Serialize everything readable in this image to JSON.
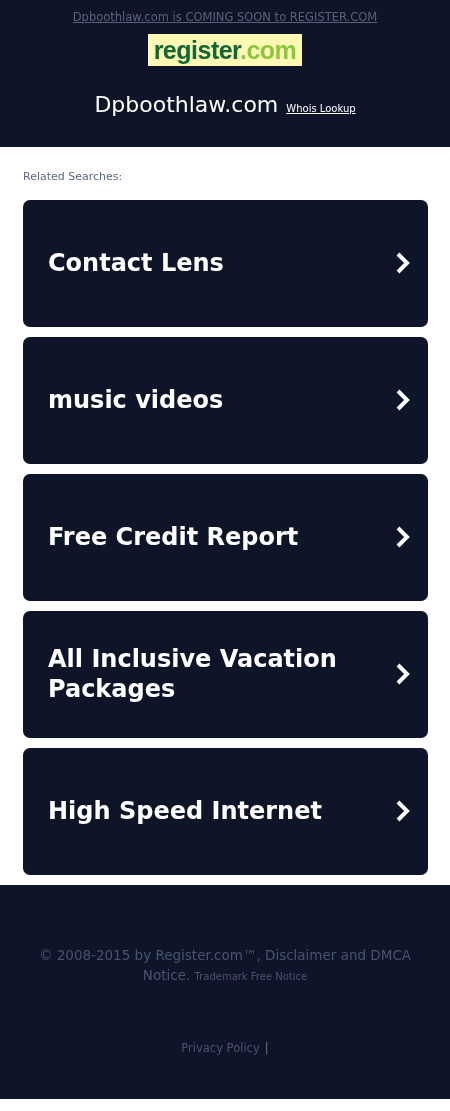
{
  "banner": {
    "text": "Dpboothlaw.com is COMING SOON to REGISTER.COM"
  },
  "logo": {
    "main": "register",
    "suffix": ".com"
  },
  "domain": {
    "name": "Dpboothlaw.com",
    "whois_link": "Whois Lookup"
  },
  "related_searches": {
    "heading": "Related Searches:",
    "items": [
      {
        "label": "Contact Lens"
      },
      {
        "label": "music videos"
      },
      {
        "label": "Free Credit Report"
      },
      {
        "label": "All Inclusive Vacation Packages"
      },
      {
        "label": "High Speed Internet"
      }
    ]
  },
  "footer": {
    "copyright": "© 2008-2015 by Register.com™, Disclaimer and DMCA Notice.",
    "trademark_link": "Trademark Free Notice",
    "privacy_link": "Privacy Policy",
    "separator": "|"
  }
}
